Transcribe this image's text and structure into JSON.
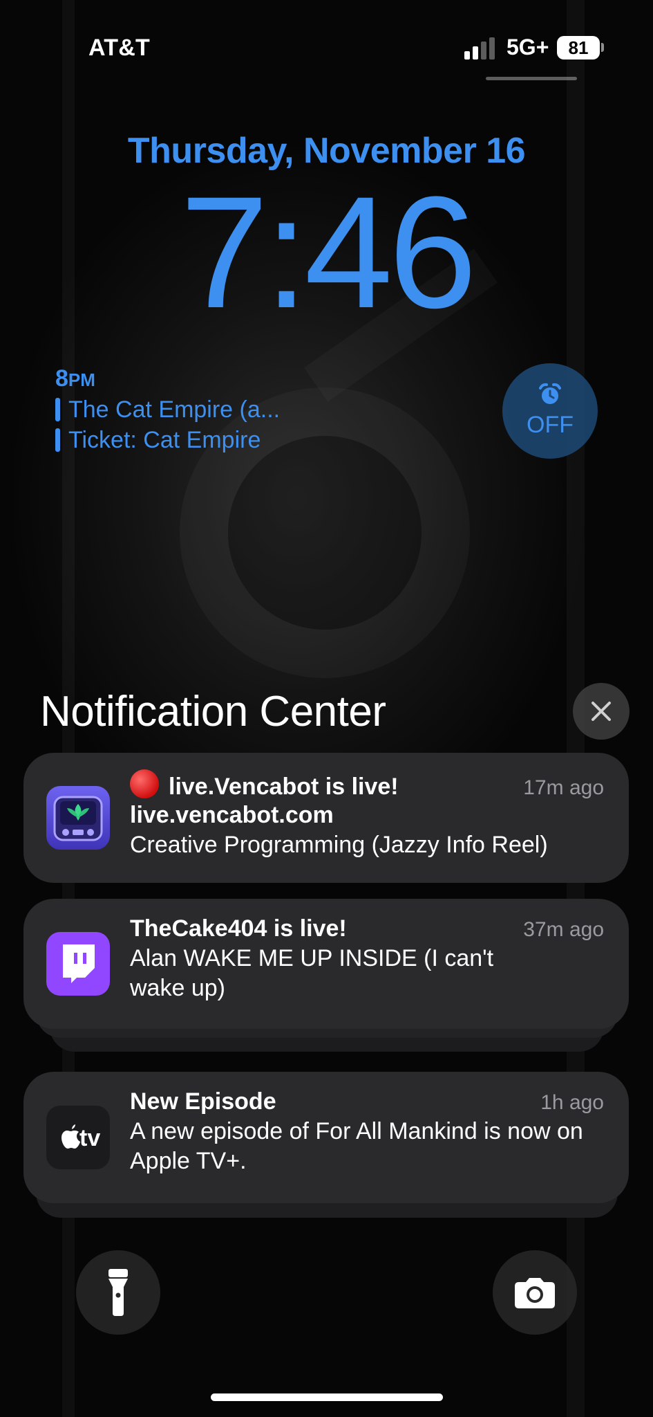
{
  "status_bar": {
    "carrier": "AT&T",
    "network": "5G+",
    "battery": "81",
    "signal_icon": "signal-bars-icon"
  },
  "lockscreen": {
    "date": "Thursday, November 16",
    "time": "7:46"
  },
  "calendar_widget": {
    "time": "8",
    "time_suffix": "PM",
    "events": [
      "The Cat Empire (a...",
      "Ticket: Cat Empire"
    ]
  },
  "alarm_widget": {
    "label": "OFF",
    "icon": "alarm-clock-icon"
  },
  "notification_center": {
    "title": "Notification Center",
    "close_icon": "close-icon"
  },
  "notifications": [
    {
      "app_icon": "live-vencabot-tv-icon",
      "title": "live.Vencabot is live!",
      "subtitle": "live.vencabot.com",
      "body": "Creative Programming (Jazzy Info Reel)",
      "time": "17m ago"
    },
    {
      "app_icon": "twitch-icon",
      "title": "TheCake404 is live!",
      "body": "Alan WAKE ME UP INSIDE (I can't wake up)",
      "time": "37m ago"
    },
    {
      "app_icon": "apple-tv-icon",
      "icon_label": "tv",
      "title": "New Episode",
      "body": "A new episode of For All Mankind is now on Apple TV+.",
      "time": "1h ago"
    }
  ],
  "bottom_controls": {
    "flashlight_icon": "flashlight-icon",
    "camera_icon": "camera-icon"
  },
  "colors": {
    "accent": "#3d8ff0",
    "card": "#2a2a2c",
    "twitch": "#9146ff",
    "vencabot": "#5b4fd6"
  }
}
